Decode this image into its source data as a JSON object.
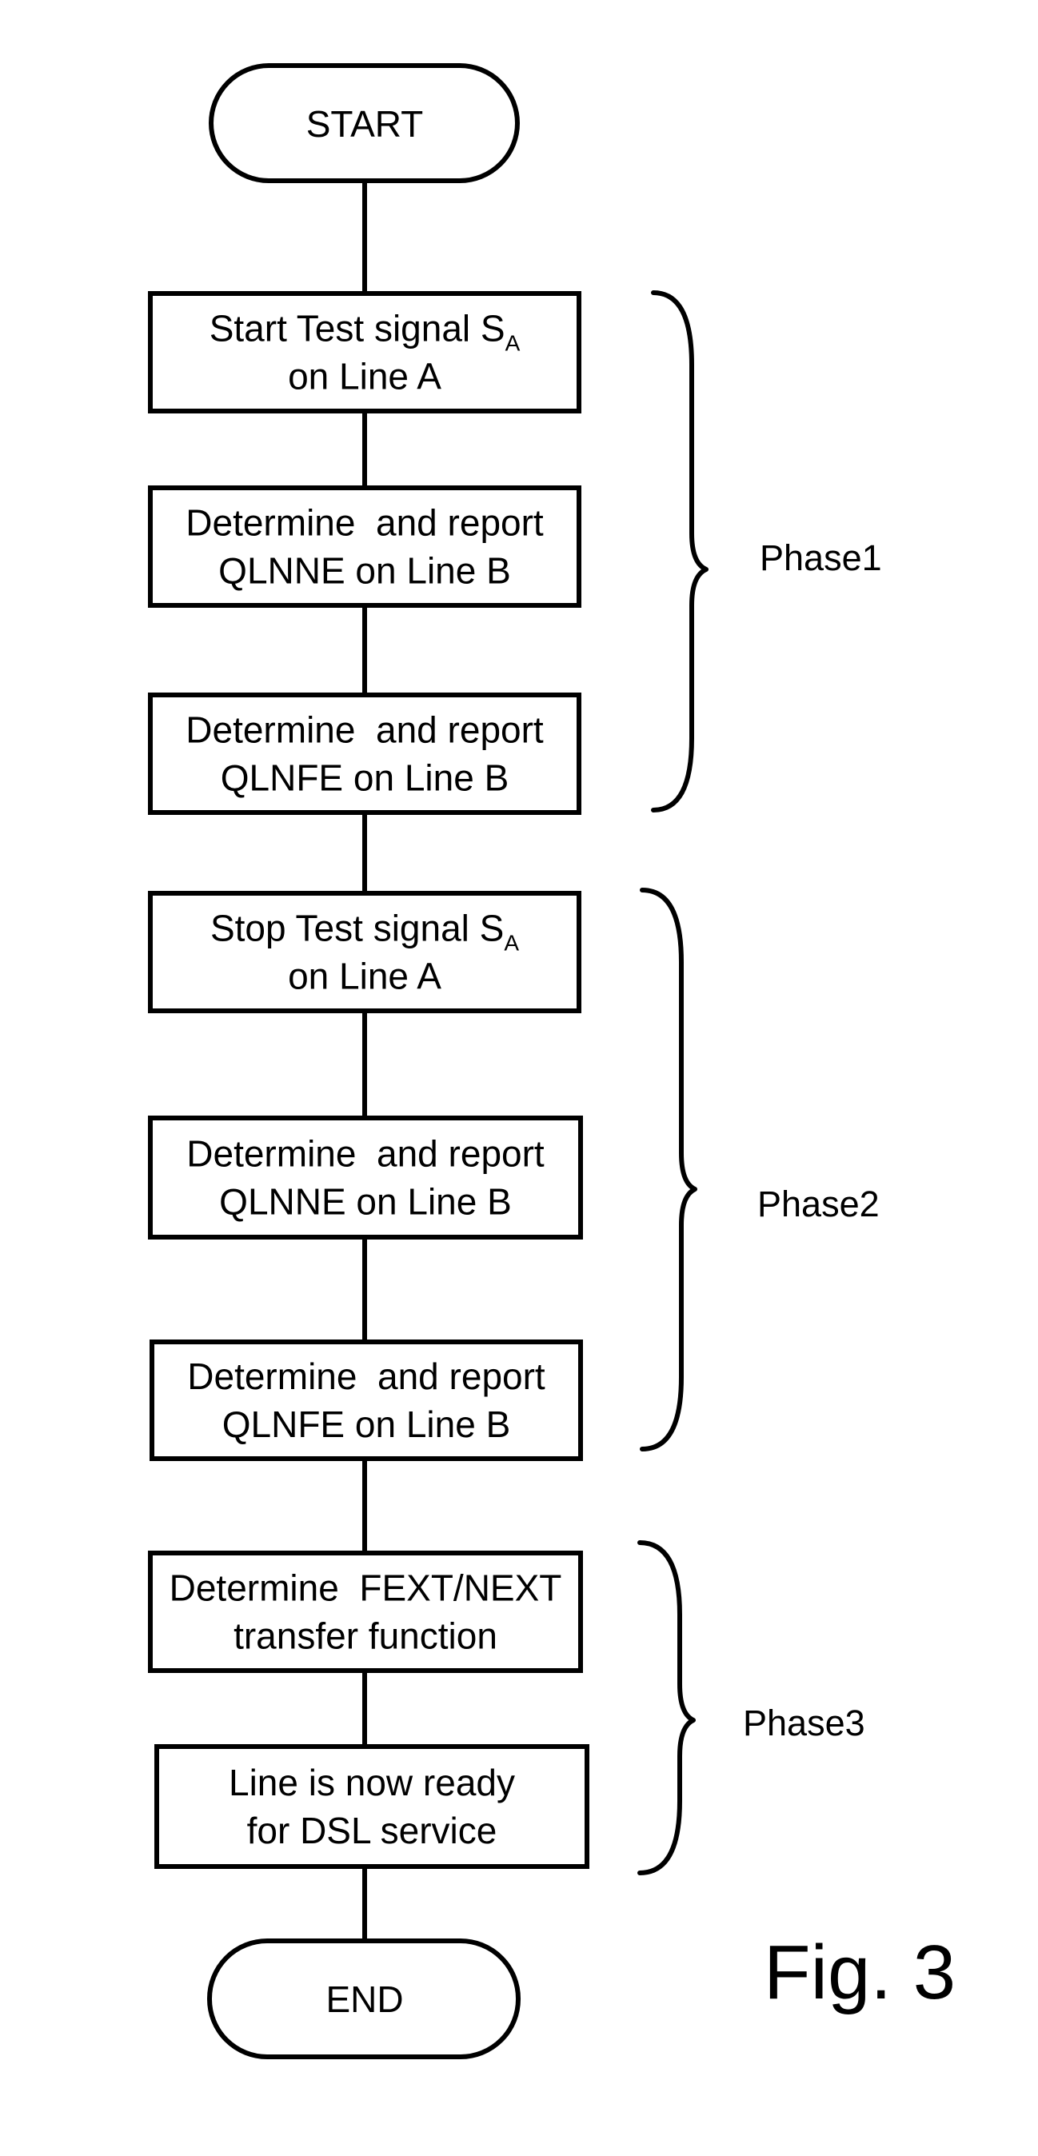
{
  "figure": {
    "label": "Fig. 3",
    "start": {
      "label": "START"
    },
    "end": {
      "label": "END"
    },
    "steps": [
      {
        "id": "step-start-test-signal",
        "lines": [
          {
            "text": "Start Test signal S",
            "sub": "A"
          },
          {
            "text": "on Line A"
          }
        ]
      },
      {
        "id": "step-report-qlnne-1",
        "lines": [
          {
            "text": "Determine  and report"
          },
          {
            "text": "QLNNE on Line B"
          }
        ]
      },
      {
        "id": "step-report-qlnfe-1",
        "lines": [
          {
            "text": "Determine  and report"
          },
          {
            "text": "QLNFE on Line B"
          }
        ]
      },
      {
        "id": "step-stop-test-signal",
        "lines": [
          {
            "text": "Stop Test signal S",
            "sub": "A"
          },
          {
            "text": "on Line A"
          }
        ]
      },
      {
        "id": "step-report-qlnne-2",
        "lines": [
          {
            "text": "Determine  and report"
          },
          {
            "text": "QLNNE on Line B"
          }
        ]
      },
      {
        "id": "step-report-qlnfe-2",
        "lines": [
          {
            "text": "Determine  and report"
          },
          {
            "text": "QLNFE on Line B"
          }
        ]
      },
      {
        "id": "step-determine-transfer-function",
        "lines": [
          {
            "text": "Determine  FEXT/NEXT"
          },
          {
            "text": "transfer function"
          }
        ]
      },
      {
        "id": "step-line-ready",
        "lines": [
          {
            "text": "Line is now ready"
          },
          {
            "text": "for DSL service"
          }
        ]
      }
    ],
    "phases": [
      {
        "label": "Phase1",
        "first_step": 0,
        "last_step": 2
      },
      {
        "label": "Phase2",
        "first_step": 3,
        "last_step": 5
      },
      {
        "label": "Phase3",
        "first_step": 6,
        "last_step": 7
      }
    ],
    "colors": {
      "ink": "#000000",
      "paper": "#ffffff"
    }
  }
}
